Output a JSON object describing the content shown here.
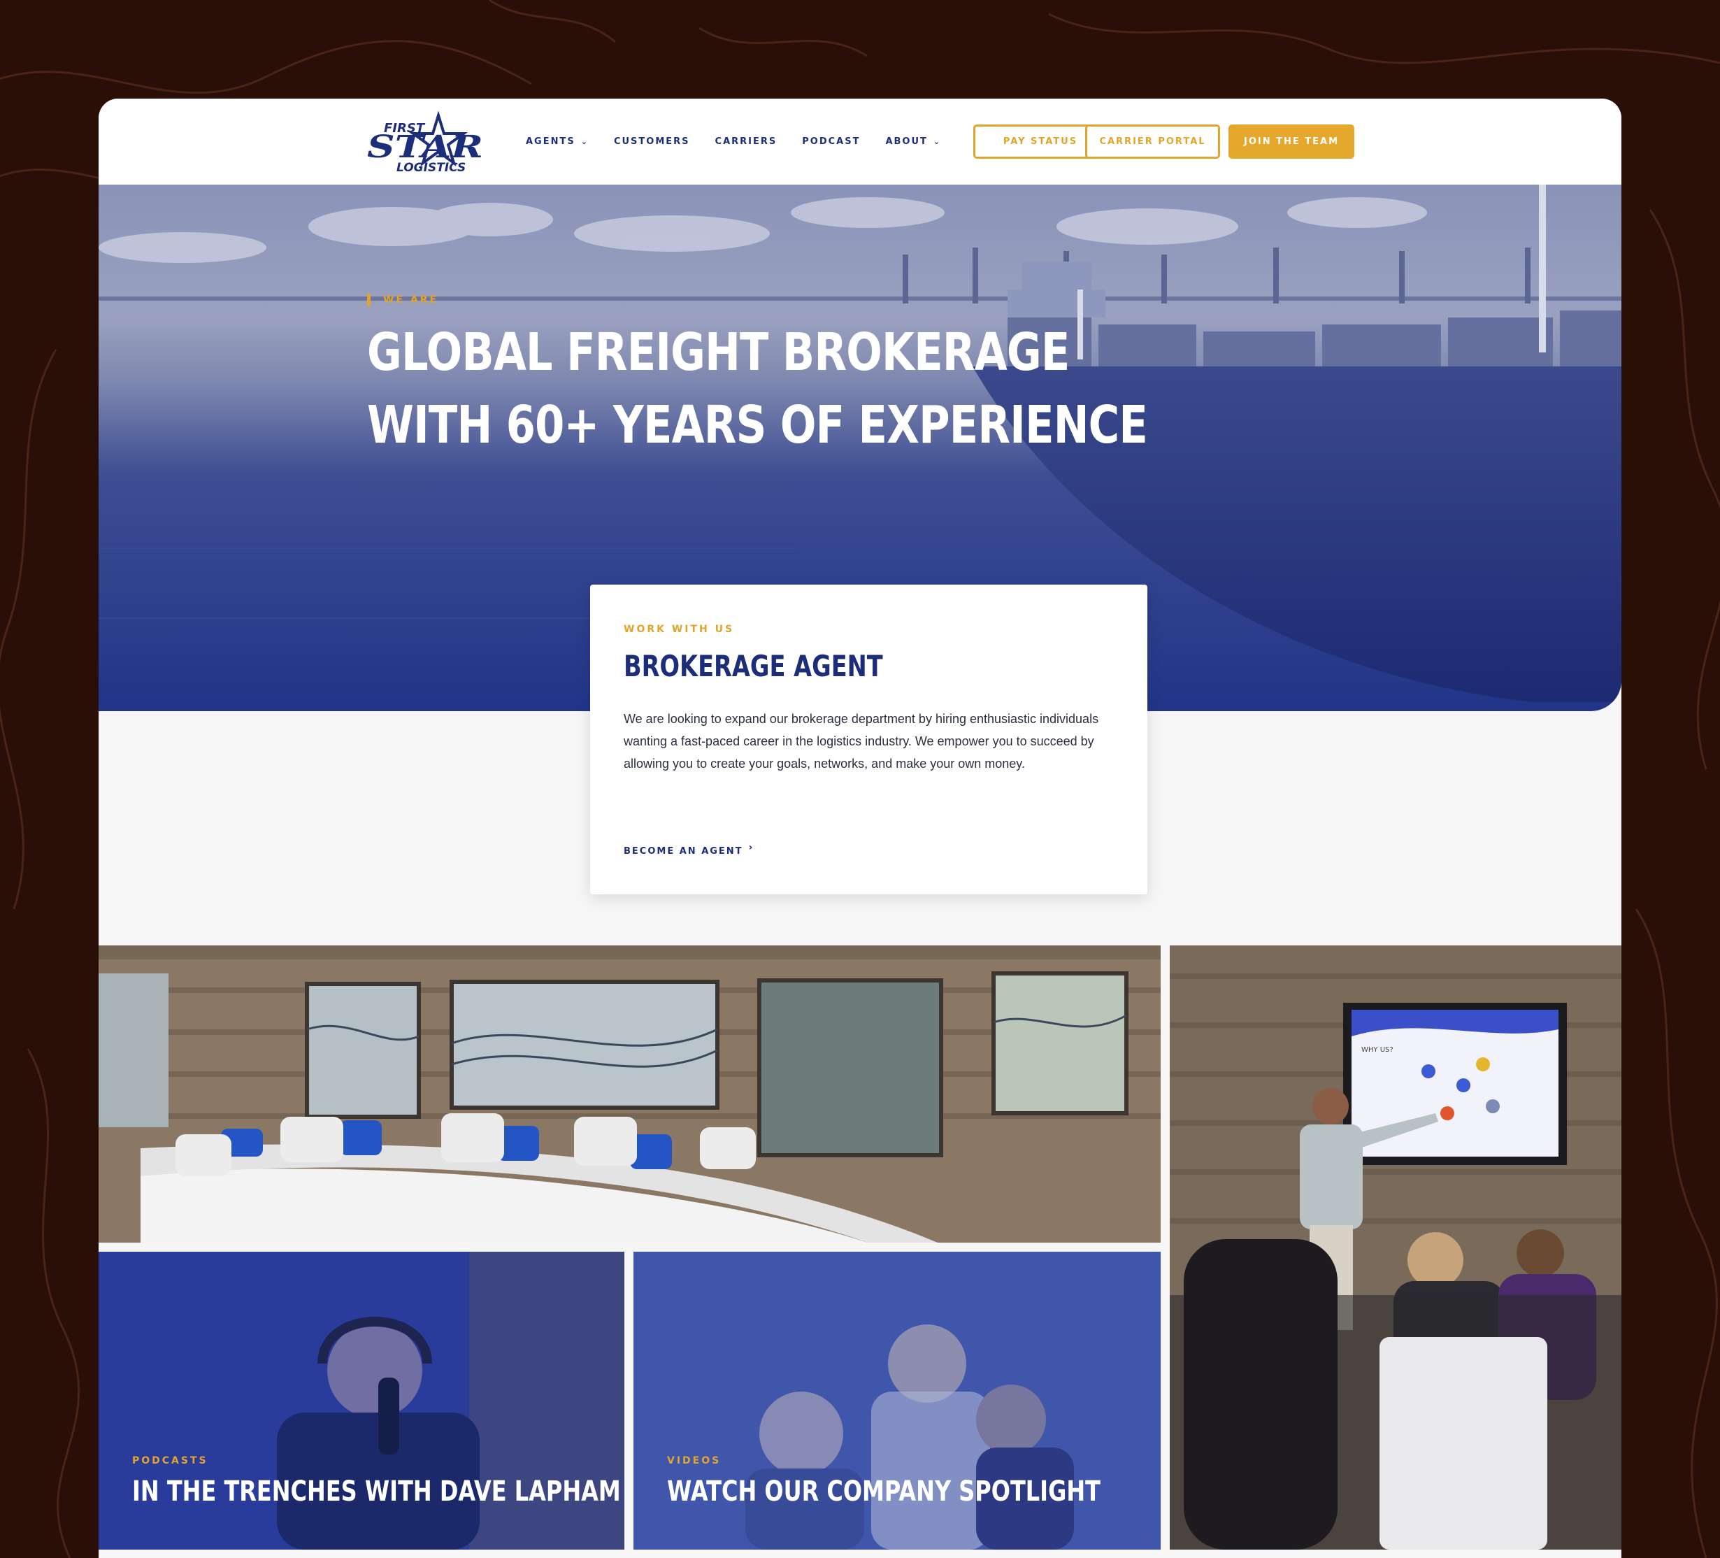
{
  "brand": {
    "line1": "FIRST",
    "line2": "STAR",
    "line3": "LOGISTICS"
  },
  "nav": [
    {
      "label": "AGENTS",
      "has_dropdown": true
    },
    {
      "label": "CUSTOMERS",
      "has_dropdown": false
    },
    {
      "label": "CARRIERS",
      "has_dropdown": false
    },
    {
      "label": "PODCAST",
      "has_dropdown": false
    },
    {
      "label": "ABOUT",
      "has_dropdown": true
    }
  ],
  "buttons": {
    "pay_status": "PAY STATUS",
    "carrier_portal": "CARRIER PORTAL",
    "join": "JOIN THE TEAM"
  },
  "hero": {
    "eyebrow": "WE ARE",
    "title_line1": "GLOBAL FREIGHT BROKERAGE",
    "title_line2": "WITH 60+ YEARS OF EXPERIENCE"
  },
  "promo": {
    "eyebrow": "WORK WITH US",
    "title": "BROKERAGE AGENT",
    "body": "We are looking to expand our brokerage department by hiring enthusiastic individuals wanting a fast-paced career in the logistics industry. We empower you to succeed by allowing you to create your goals, networks, and make your own money.",
    "link": "BECOME AN AGENT"
  },
  "gallery": {
    "podcast": {
      "label": "PODCASTS",
      "title": "IN THE TRENCHES WITH DAVE LAPHAM"
    },
    "video": {
      "label": "VIDEOS",
      "title": "WATCH OUR COMPANY SPOTLIGHT"
    },
    "screen_text": "WHY US?"
  },
  "colors": {
    "navy": "#1c2e7a",
    "gold": "#e2a52c",
    "backdrop": "#2a0f08"
  }
}
